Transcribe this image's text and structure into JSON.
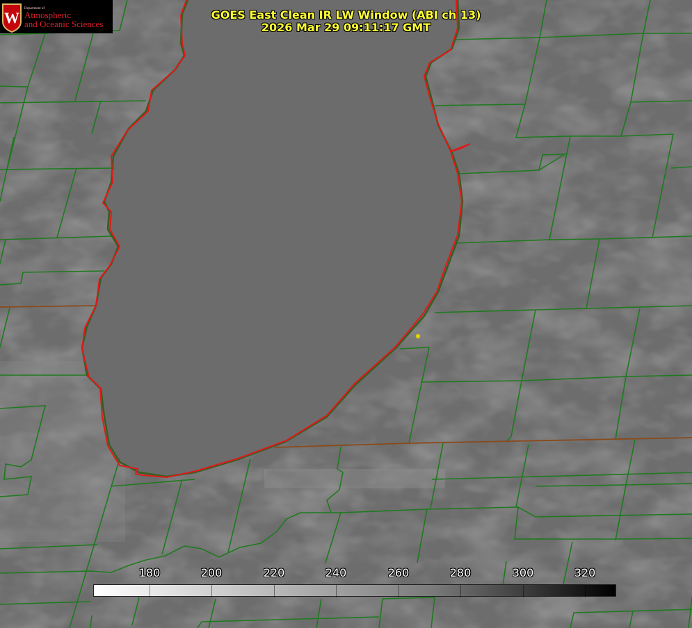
{
  "header": {
    "title_line1": "GOES East Clean IR LW Window (ABI ch 13)",
    "title_line2": "2026 Mar 29 09:11:17 GMT"
  },
  "logo": {
    "department": "Department of",
    "unit_line1": "Atmospheric",
    "unit_line2": "and Oceanic Sciences",
    "seal_letter": "W"
  },
  "colorbar": {
    "ticks": [
      "180",
      "200",
      "220",
      "240",
      "260",
      "280",
      "300",
      "320"
    ],
    "gradient": [
      "#ffffff",
      "#000000"
    ]
  },
  "colors": {
    "title": "#ffff33",
    "county_lines": "#1f7a1f",
    "shoreline": "#e01919",
    "marker": "#e0d100",
    "background_gray": "#6f6f6f"
  }
}
